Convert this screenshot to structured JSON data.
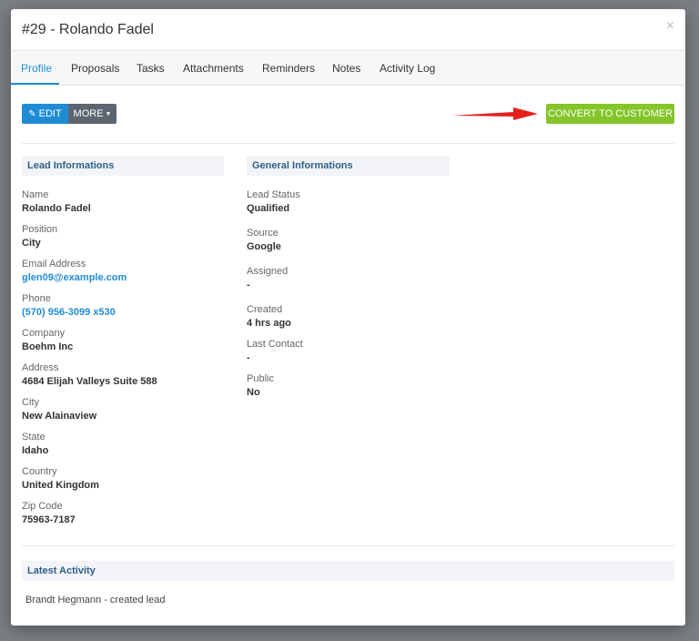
{
  "modal": {
    "title": "#29 - Rolando Fadel",
    "close": "×"
  },
  "tabs": [
    {
      "label": "Profile",
      "active": true
    },
    {
      "label": "Proposals"
    },
    {
      "label": "Tasks"
    },
    {
      "label": "Attachments"
    },
    {
      "label": "Reminders"
    },
    {
      "label": "Notes"
    },
    {
      "label": "Activity Log"
    }
  ],
  "toolbar": {
    "edit_label": "EDIT",
    "more_label": "MORE",
    "convert_label": "CONVERT TO CUSTOMER"
  },
  "lead_info": {
    "heading": "Lead Informations",
    "fields": [
      {
        "label": "Name",
        "value": "Rolando Fadel"
      },
      {
        "label": "Position",
        "value": "City"
      },
      {
        "label": "Email Address",
        "value": "glen09@example.com"
      },
      {
        "label": "Phone",
        "value": "(570) 956-3099 x530"
      },
      {
        "label": "Company",
        "value": "Boehm Inc"
      },
      {
        "label": "Address",
        "value": "4684 Elijah Valleys Suite 588"
      },
      {
        "label": "City",
        "value": "New Alainaview"
      },
      {
        "label": "State",
        "value": "Idaho"
      },
      {
        "label": "Country",
        "value": "United Kingdom"
      },
      {
        "label": "Zip Code",
        "value": "75963-7187"
      }
    ]
  },
  "general_info": {
    "heading": "General Informations",
    "fields": [
      {
        "label": "Lead Status",
        "value": "Qualified"
      },
      {
        "label": "Source",
        "value": "Google"
      },
      {
        "label": "Assigned",
        "value": "-"
      },
      {
        "label": "Created",
        "value": "4 hrs ago"
      },
      {
        "label": "Last Contact",
        "value": "-"
      },
      {
        "label": "Public",
        "value": "No"
      }
    ]
  },
  "latest_activity": {
    "heading": "Latest Activity",
    "text": "Brandt Hegmann - created lead"
  },
  "colors": {
    "primary": "#1f8dd6",
    "success": "#84c529",
    "arrow": "#e3201b"
  }
}
